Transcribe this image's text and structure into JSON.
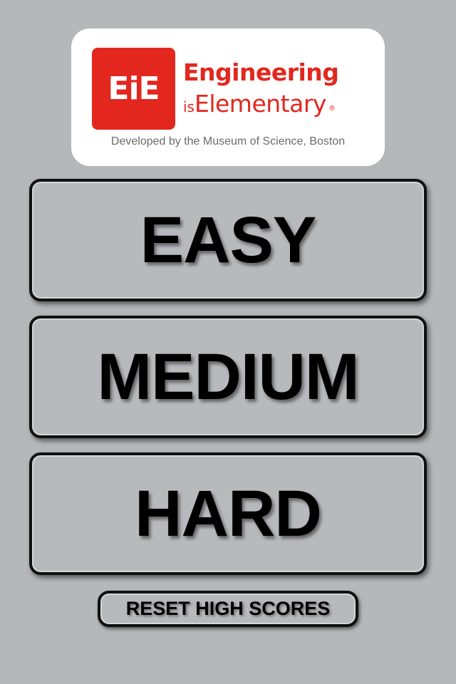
{
  "colors": {
    "background": "#b6b7bb",
    "brand_red": "#e3271e",
    "button_border": "#111111",
    "button_text": "#000000"
  },
  "logo": {
    "mark_text": "EiE",
    "word_line1": "Engineering",
    "word_is": "is",
    "word_elementary": "Elementary",
    "registered": "®",
    "tagline": "Developed by the Museum of Science, Boston"
  },
  "menu": {
    "easy_label": "EASY",
    "medium_label": "MEDIUM",
    "hard_label": "HARD",
    "reset_label": "RESET HIGH SCORES"
  }
}
